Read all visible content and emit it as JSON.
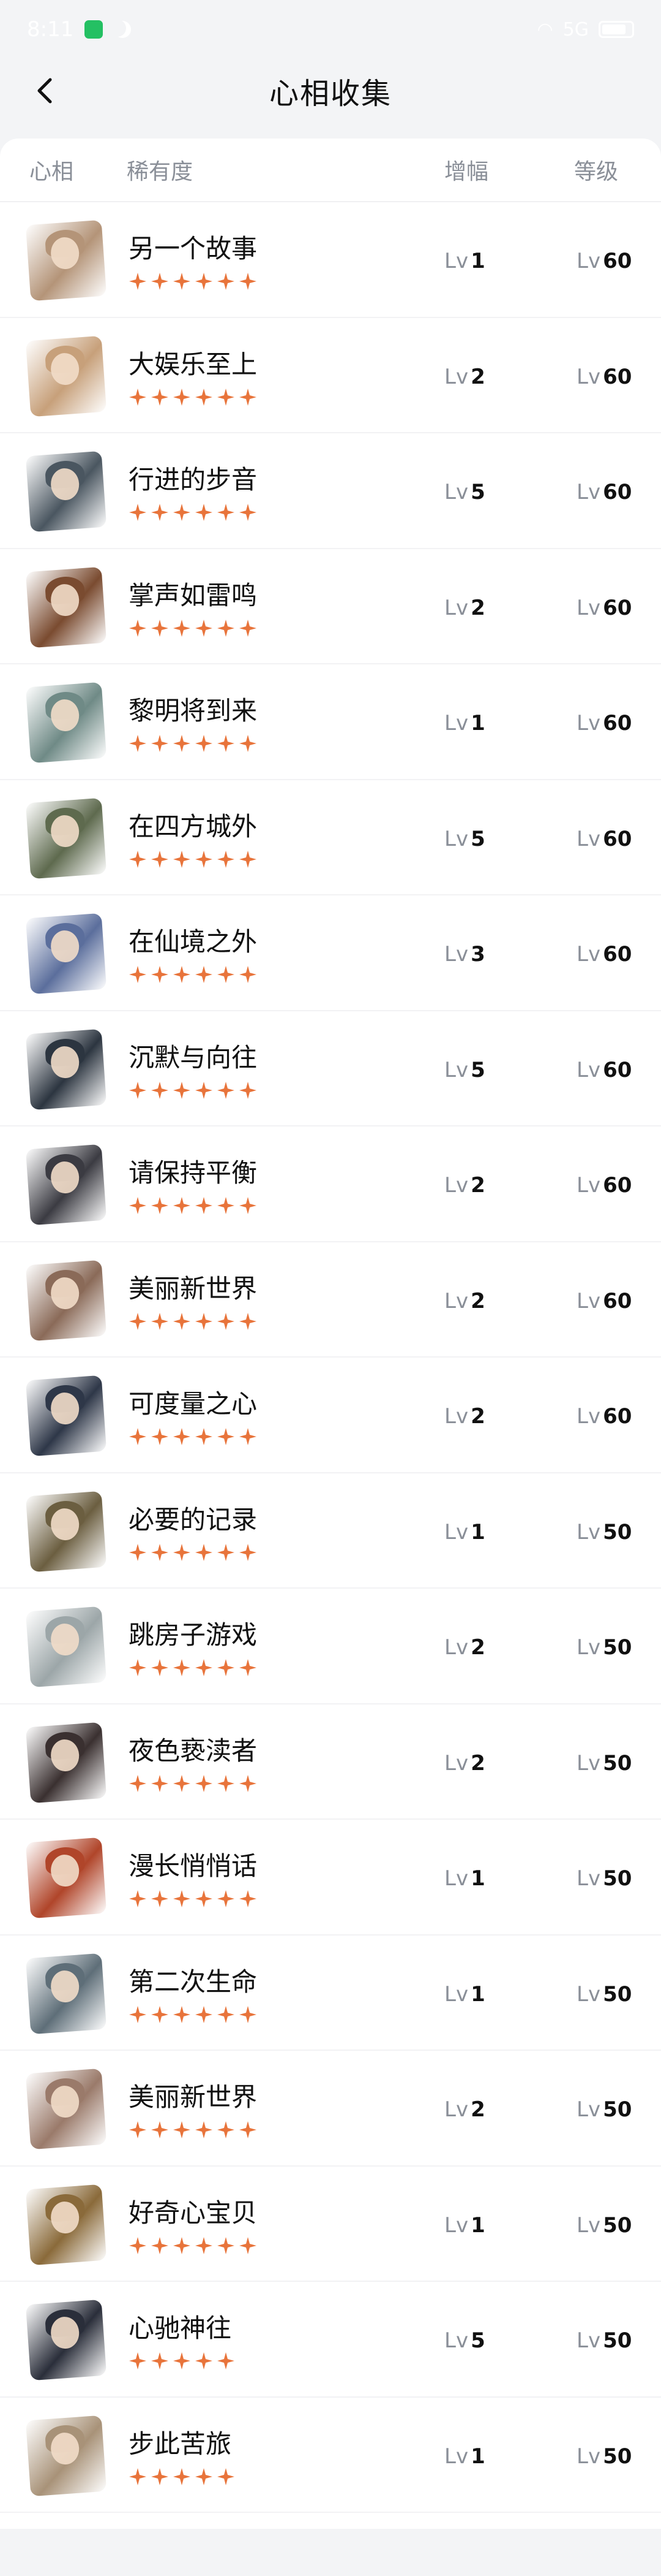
{
  "status_bar": {
    "time": "8:11",
    "signal_text": "5G"
  },
  "header": {
    "title": "心相收集"
  },
  "columns": {
    "avatar": "心相",
    "rarity": "稀有度",
    "boost": "增幅",
    "level": "等级"
  },
  "lv_prefix": "Lv",
  "colors": {
    "star": "#e8743b",
    "accent_bg": "#f3f4f6"
  },
  "items": [
    {
      "name": "另一个故事",
      "stars": 6,
      "boost": "1",
      "level": "60",
      "tint": "#b49478"
    },
    {
      "name": "大娱乐至上",
      "stars": 6,
      "boost": "2",
      "level": "60",
      "tint": "#c7a07a"
    },
    {
      "name": "行进的步音",
      "stars": 6,
      "boost": "5",
      "level": "60",
      "tint": "#4a5660"
    },
    {
      "name": "掌声如雷鸣",
      "stars": 6,
      "boost": "2",
      "level": "60",
      "tint": "#7a4b30"
    },
    {
      "name": "黎明将到来",
      "stars": 6,
      "boost": "1",
      "level": "60",
      "tint": "#6f8a86"
    },
    {
      "name": "在四方城外",
      "stars": 6,
      "boost": "5",
      "level": "60",
      "tint": "#5e6a4e"
    },
    {
      "name": "在仙境之外",
      "stars": 6,
      "boost": "3",
      "level": "60",
      "tint": "#5b6e9c"
    },
    {
      "name": "沉默与向往",
      "stars": 6,
      "boost": "5",
      "level": "60",
      "tint": "#2c3540"
    },
    {
      "name": "请保持平衡",
      "stars": 6,
      "boost": "2",
      "level": "60",
      "tint": "#3b3b42"
    },
    {
      "name": "美丽新世界",
      "stars": 6,
      "boost": "2",
      "level": "60",
      "tint": "#8a6a58"
    },
    {
      "name": "可度量之心",
      "stars": 6,
      "boost": "2",
      "level": "60",
      "tint": "#2e3748"
    },
    {
      "name": "必要的记录",
      "stars": 6,
      "boost": "1",
      "level": "50",
      "tint": "#6b5e40"
    },
    {
      "name": "跳房子游戏",
      "stars": 6,
      "boost": "2",
      "level": "50",
      "tint": "#9ca6a8"
    },
    {
      "name": "夜色亵渎者",
      "stars": 6,
      "boost": "2",
      "level": "50",
      "tint": "#3a3030"
    },
    {
      "name": "漫长悄悄话",
      "stars": 6,
      "boost": "1",
      "level": "50",
      "tint": "#b0452a"
    },
    {
      "name": "第二次生命",
      "stars": 6,
      "boost": "1",
      "level": "50",
      "tint": "#5e6e78"
    },
    {
      "name": "美丽新世界",
      "stars": 6,
      "boost": "2",
      "level": "50",
      "tint": "#9a7a6a"
    },
    {
      "name": "好奇心宝贝",
      "stars": 6,
      "boost": "1",
      "level": "50",
      "tint": "#8a6a3a"
    },
    {
      "name": "心驰神往",
      "stars": 5,
      "boost": "5",
      "level": "50",
      "tint": "#2a2e3a"
    },
    {
      "name": "步此苦旅",
      "stars": 5,
      "boost": "1",
      "level": "50",
      "tint": "#a89278"
    }
  ]
}
